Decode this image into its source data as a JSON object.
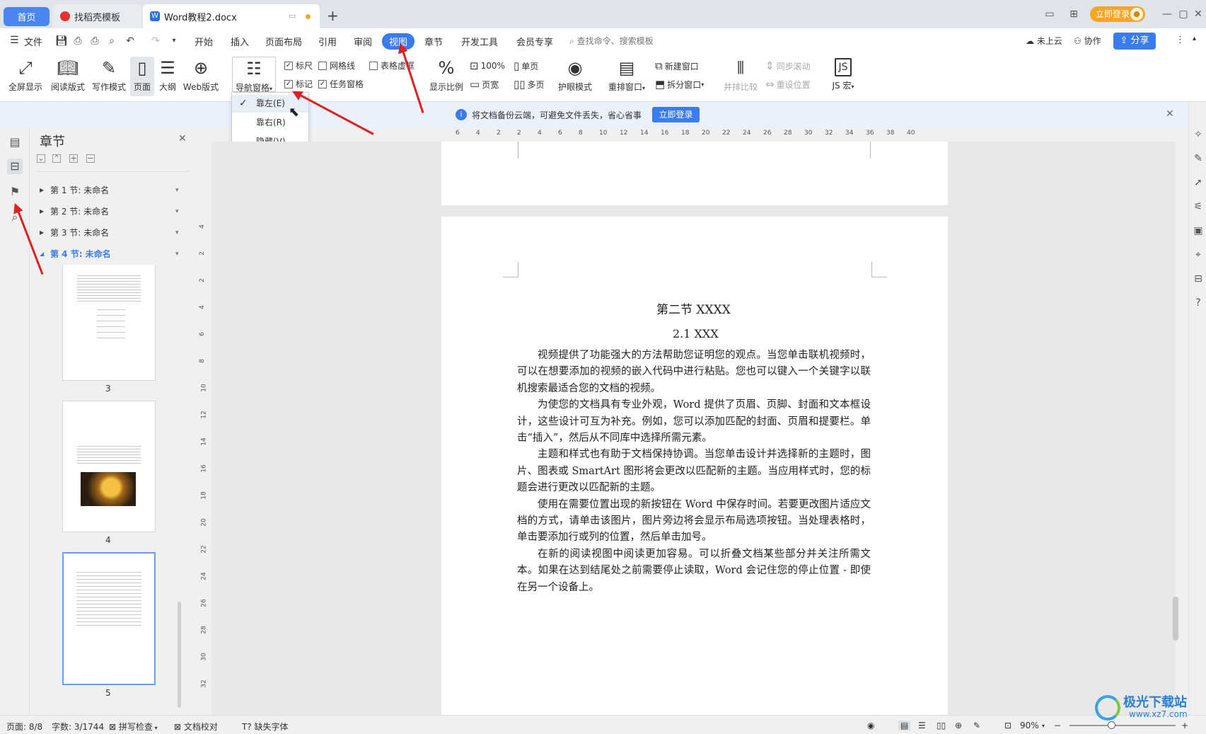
{
  "tabs": {
    "home": "首页",
    "template": "找稻壳模板",
    "document": "Word教程2.docx"
  },
  "titlebar": {
    "login": "立即登录"
  },
  "menu": {
    "file": "文件",
    "items": [
      "开始",
      "插入",
      "页面布局",
      "引用",
      "审阅",
      "视图",
      "章节",
      "开发工具",
      "会员专享"
    ],
    "active": "视图",
    "search_placeholder": "查找命令、搜索模板",
    "cloud": "未上云",
    "collab": "协作",
    "share": "分享"
  },
  "ribbon": {
    "fullscreen": "全屏显示",
    "read_mode": "阅读版式",
    "write_mode": "写作模式",
    "page": "页面",
    "outline": "大纲",
    "web": "Web版式",
    "nav_pane": "导航窗格",
    "ruler": "标尺",
    "gridlines": "网格线",
    "table_dash": "表格虚框",
    "marks": "标记",
    "task_pane": "任务窗格",
    "zoom": "显示比例",
    "zoom_100": "100%",
    "single_page": "单页",
    "page_width": "页宽",
    "multi_page": "多页",
    "eye_care": "护眼模式",
    "rearrange": "重排窗口",
    "new_window": "新建窗口",
    "split_window": "拆分窗口",
    "compare": "并排比较",
    "sync_scroll": "同步滚动",
    "reset_pos": "重设位置",
    "js_macro": "JS 宏"
  },
  "dropdown": {
    "items": [
      "靠左(E)",
      "靠右(R)",
      "隐藏(V)"
    ],
    "checked_index": 0
  },
  "infobar": {
    "message": "将文档备份云端，可避免文件丢失，省心省事",
    "button": "立即登录"
  },
  "navpane": {
    "title": "章节",
    "sections": [
      "第 1 节: 未命名",
      "第 2 节: 未命名",
      "第 3 节: 未命名",
      "第 4 节: 未命名"
    ],
    "active_index": 3,
    "thumb_numbers": [
      "3",
      "4",
      "5"
    ]
  },
  "ruler": {
    "h_ticks": [
      "6",
      "4",
      "2",
      "2",
      "4",
      "6",
      "8",
      "10",
      "12",
      "14",
      "16",
      "18",
      "20",
      "22",
      "24",
      "26",
      "28",
      "30",
      "32",
      "34",
      "36",
      "38",
      "40"
    ],
    "v_ticks": [
      "4",
      "2",
      "2",
      "4",
      "6",
      "8",
      "10",
      "12",
      "14",
      "16",
      "18",
      "20",
      "22",
      "24",
      "26",
      "28",
      "30",
      "32"
    ]
  },
  "document": {
    "heading": "第二节  XXXX",
    "subheading": "2.1 XXX",
    "paragraphs": [
      "视频提供了功能强大的方法帮助您证明您的观点。当您单击联机视频时，可以在想要添加的视频的嵌入代码中进行粘贴。您也可以键入一个关键字以联机搜索最适合您的文档的视频。",
      "为使您的文档具有专业外观，Word 提供了页眉、页脚、封面和文本框设计，这些设计可互为补充。例如，您可以添加匹配的封面、页眉和提要栏。单击“插入”，然后从不同库中选择所需元素。",
      "主题和样式也有助于文档保持协调。当您单击设计并选择新的主题时，图片、图表或 SmartArt 图形将会更改以匹配新的主题。当应用样式时，您的标题会进行更改以匹配新的主题。",
      "使用在需要位置出现的新按钮在 Word 中保存时间。若要更改图片适应文档的方式，请单击该图片，图片旁边将会显示布局选项按钮。当处理表格时，单击要添加行或列的位置，然后单击加号。",
      "在新的阅读视图中阅读更加容易。可以折叠文档某些部分并关注所需文本。如果在达到结尾处之前需要停止读取，Word 会记住您的停止位置 - 即使在另一个设备上。"
    ]
  },
  "statusbar": {
    "page": "页面: 8/8",
    "words": "字数: 3/1744",
    "spell": "拼写检查",
    "proof": "文档校对",
    "missing_font": "缺失字体",
    "zoom": "90%"
  },
  "watermark": {
    "name": "极光下载站",
    "url": "www.xz7.com"
  }
}
